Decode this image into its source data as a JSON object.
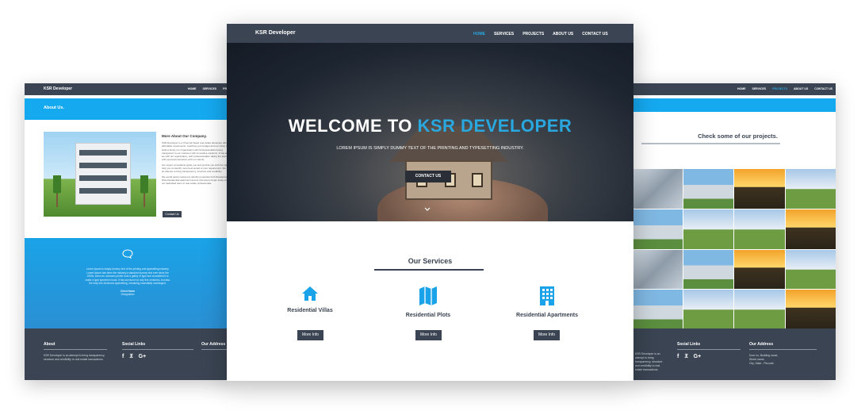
{
  "left_screen": {
    "brand": "KSR Developer",
    "menu": [
      "HOME",
      "SERVICES",
      "PROJ"
    ],
    "band_title": "About Us.",
    "about_heading": "More About Our Company.",
    "about_paragraphs": [
      "KSR Developer is a Chennai based real estate developer offering affordable investments, matching your budget and our vision to build a family run Organization with Professionalism being transparent to our customer with innovative solutions. It has and we with our organization, with professionalism taking the lead with personal interaction with our clients.",
      "Our expert consultants guide you and provide you with the right help you to identify more best suited to your requirement. We are an attempt to bring transparency, structure and credibility.",
      "We would assist customers identify properties both Residential Plots,Residential apartment across Chennai to begin today with our dedicated team of real estate professionals."
    ],
    "about_button": "Contact Us",
    "testimonial_text": "Lorem Ipsum is simply dummy text of the printing and typesetting industry. Lorem Ipsum has been the industry's standard dummy text ever since the 1500s, when an unknown printer took a galley of type and scrambled it to make a type specimen book. It has survived not only five centuries, but also the leap into electronic typesetting, remaining essentially unchanged.",
    "client_name": "Client Name",
    "client_designation": "Designation",
    "footer": {
      "about_title": "About",
      "about_text": "KSR Developer is an attempt to bring transparency, structure and credibility to real estate transactions.",
      "social_title": "Social Links",
      "address_title": "Our Address"
    }
  },
  "center_screen": {
    "brand": "KSR Developer",
    "menu": [
      "HOME",
      "SERVICES",
      "PROJECTS",
      "ABOUT US",
      "CONTACT US"
    ],
    "hero_title_1": "WELCOME TO ",
    "hero_title_2": "KSR DEVELOPER",
    "hero_subtitle": "LOREM IPSUM IS SIMPLY DUMMY TEXT OF THE PRINTING AND TYPESETTING INDUSTRY.",
    "hero_button": "CONTACT US",
    "services_title": "Our Services",
    "services": [
      {
        "label": "Residential Villas",
        "icon": "home-icon",
        "button": "More Info"
      },
      {
        "label": "Residential Plots",
        "icon": "map-icon",
        "button": "More Info"
      },
      {
        "label": "Residential Apartments",
        "icon": "building-icon",
        "button": "More Info"
      }
    ]
  },
  "right_screen": {
    "menu": [
      "HOME",
      "SERVICES",
      "PROJECTS",
      "ABOUT US",
      "CONTACT US"
    ],
    "projects_title": "Check some of our projects.",
    "footer": {
      "about_text": "KSR Developer is an attempt to bring transparency, structure and credibility to real estate transactions.",
      "social_title": "Social Links",
      "address_title": "Our Address",
      "address_lines": [
        "Door no, Building name,",
        "Street name,",
        "City, State - Pincode."
      ]
    }
  },
  "colors": {
    "nav": "#3a4452",
    "accent": "#29a8e0",
    "band": "#15a9f0",
    "icon": "#1aa3e8"
  }
}
